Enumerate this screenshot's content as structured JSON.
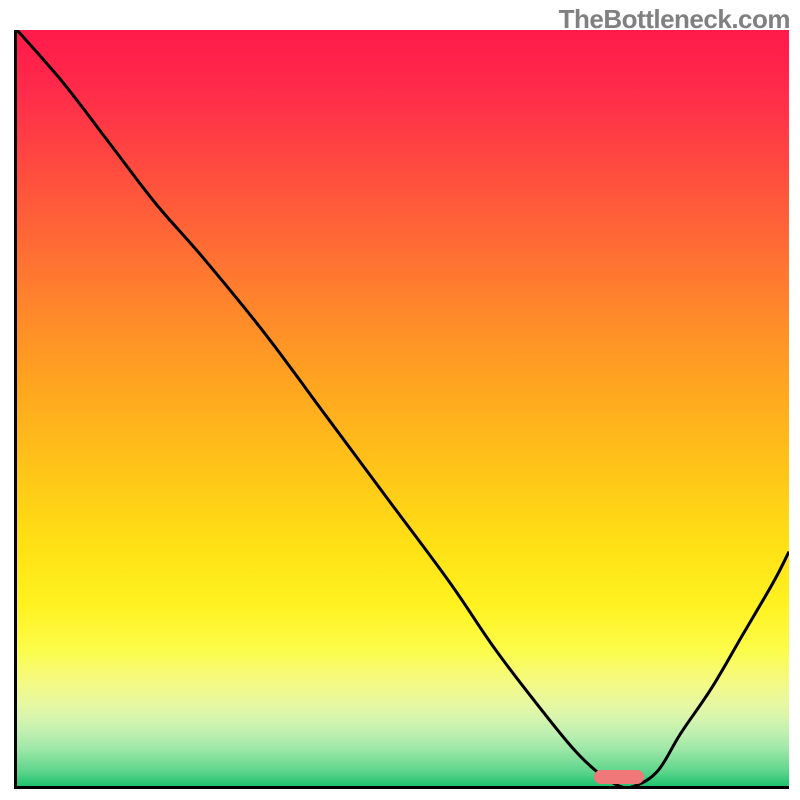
{
  "watermark": "TheBottleneck.com",
  "chart_data": {
    "type": "line",
    "title": "",
    "xlabel": "",
    "ylabel": "",
    "xlim": [
      0,
      100
    ],
    "ylim": [
      0,
      100
    ],
    "grid": false,
    "legend": false,
    "gradient_colors": {
      "top": "#ff1a4a",
      "mid_upper": "#ff8a2a",
      "mid": "#ffe015",
      "mid_lower": "#fcfc4a",
      "bottom": "#1fc270"
    },
    "series": [
      {
        "name": "bottleneck-curve",
        "color": "#000000",
        "x": [
          0,
          6,
          12,
          18,
          24,
          32,
          40,
          48,
          56,
          62,
          68,
          72,
          75,
          78,
          80,
          83,
          86,
          90,
          94,
          98,
          100
        ],
        "y": [
          100,
          93,
          85,
          77,
          70,
          60,
          49,
          38,
          27,
          18,
          10,
          5,
          2,
          0,
          0,
          2,
          7,
          13,
          20,
          27,
          31
        ]
      }
    ],
    "marker": {
      "name": "optimal-range",
      "color": "#f07878",
      "x_center": 78,
      "y": 1.2,
      "width_pct": 6.5
    }
  }
}
